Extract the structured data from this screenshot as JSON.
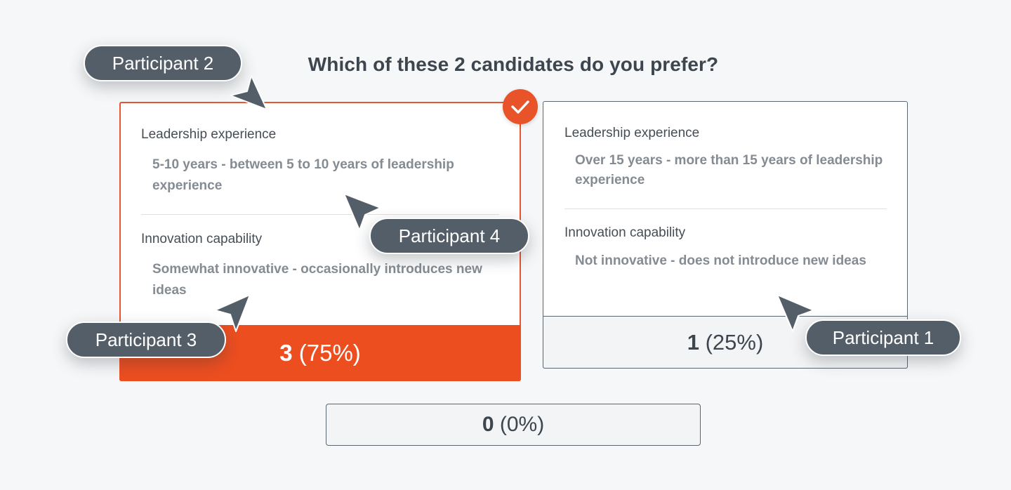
{
  "question": "Which of these 2 candidates do you prefer?",
  "candidates": [
    {
      "selected": true,
      "attributes": [
        {
          "label": "Leadership experience",
          "value": "5-10 years - between 5 to 10 years of leadership experience"
        },
        {
          "label": "Innovation capability",
          "value": "Somewhat innovative - occasionally introduces new ideas"
        }
      ],
      "result": {
        "count": "3",
        "percent": "(75%)"
      }
    },
    {
      "selected": false,
      "attributes": [
        {
          "label": "Leadership experience",
          "value": "Over 15 years - more than 15 years of leadership experience"
        },
        {
          "label": "Innovation capability",
          "value": "Not innovative - does not introduce new ideas"
        }
      ],
      "result": {
        "count": "1",
        "percent": "(25%)"
      }
    }
  ],
  "no_preference_result": {
    "count": "0",
    "percent": "(0%)"
  },
  "participants": [
    {
      "label": "Participant 2"
    },
    {
      "label": "Participant 4"
    },
    {
      "label": "Participant 3"
    },
    {
      "label": "Participant 1"
    }
  ],
  "colors": {
    "accent": "#ec4e20",
    "pill": "#545e68",
    "background": "#f6f7f8"
  },
  "icons": {
    "selected": "check-icon",
    "pointer": "cursor-arrow-icon"
  }
}
